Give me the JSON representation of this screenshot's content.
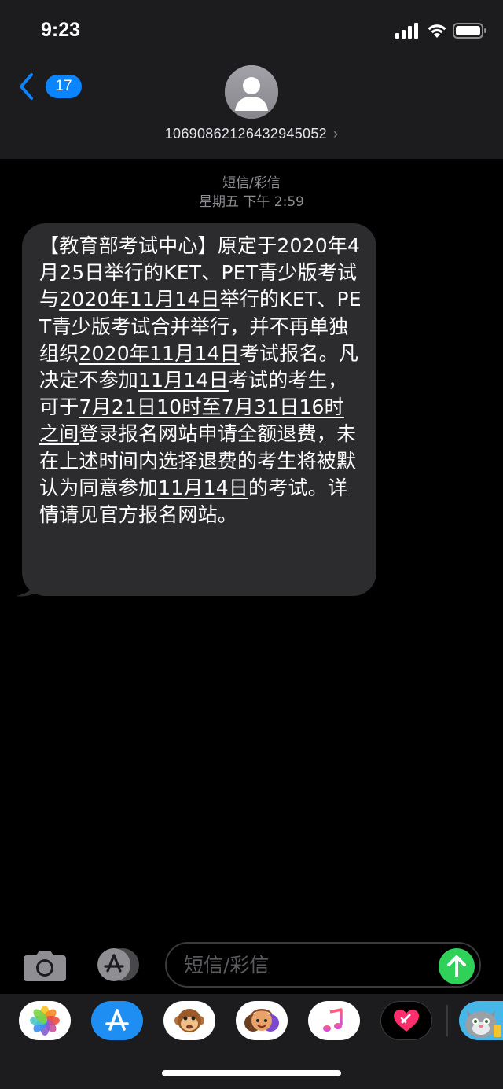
{
  "status_bar": {
    "time": "9:23",
    "icons": [
      "cellular-signal-icon",
      "wifi-icon",
      "battery-icon"
    ]
  },
  "header": {
    "back_badge": "17",
    "contact_name": "10690862126432945052",
    "contact_chevron": "›"
  },
  "thread": {
    "service_label": "短信/彩信",
    "timestamp": "星期五 下午 2:59",
    "message": {
      "t1": "【教育部考试中心】原定于2020年4月25日举行的KET、PET青少版考试与",
      "link1": "2020年11月14日",
      "t2": "举行的KET、PET青少版考试合并举行，并不再单独组织",
      "link2": "2020年11月14日",
      "t3": "考试报名。凡决定不参加",
      "link3": "11月14日",
      "t4": "考试的考生，可于",
      "link4": "7月21日10时至7月31日16时之间",
      "t5": "登录报名网站申请全额退费，未在上述时间内选择退费的考生将被默认为同意参加",
      "link5": "11月14日",
      "t6": "的考试。详情请见官方报名网站。"
    }
  },
  "compose": {
    "placeholder": "短信/彩信",
    "camera_icon": "camera-icon",
    "appstore_icon": "app-store-icon",
    "send_icon": "send-arrow-icon"
  },
  "drawer": {
    "apps": [
      "photos-app",
      "app-store-app",
      "animoji-app",
      "memoji-app",
      "music-app",
      "digital-touch-app",
      "talking-tom-app"
    ]
  },
  "colors": {
    "header_bg": "#1c1c1e",
    "bubble_bg": "#2c2c2e",
    "accent_blue": "#0a84ff",
    "send_green": "#30d158"
  }
}
